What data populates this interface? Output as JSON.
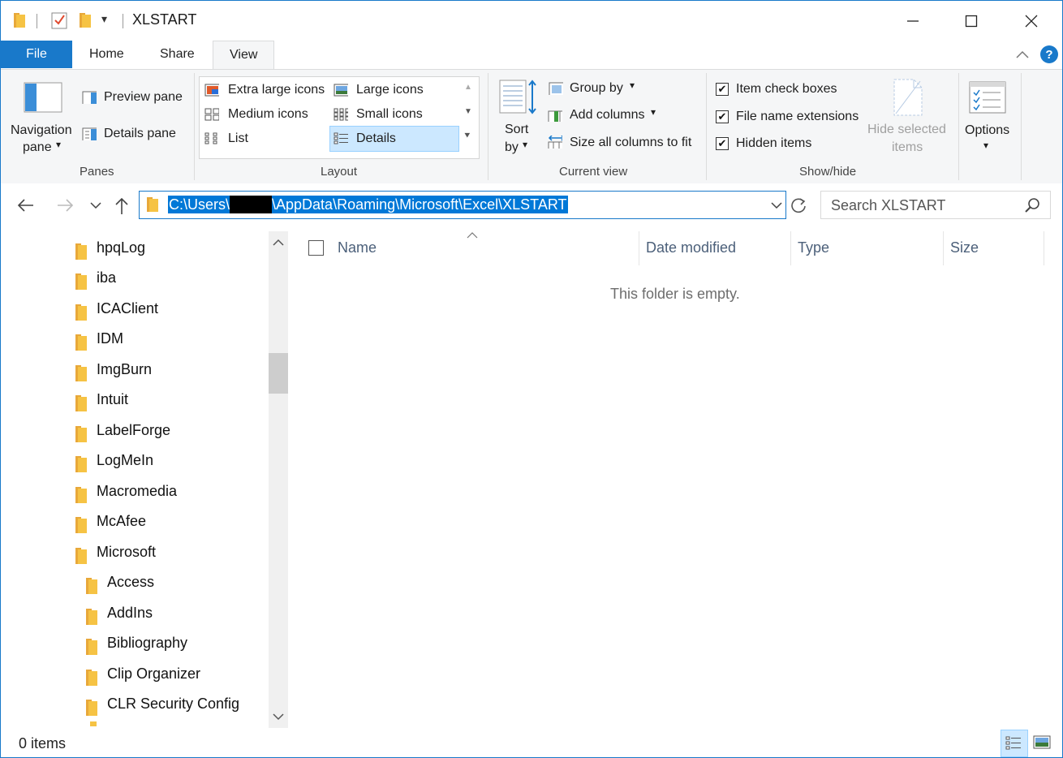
{
  "window": {
    "title": "XLSTART"
  },
  "tabs": [
    "File",
    "Home",
    "Share",
    "View"
  ],
  "ribbon": {
    "panes": {
      "navigation_pane": [
        "Navigation",
        "pane"
      ],
      "preview_pane": "Preview pane",
      "details_pane": "Details pane",
      "group_label": "Panes"
    },
    "layout": {
      "options": [
        "Extra large icons",
        "Large icons",
        "Medium icons",
        "Small icons",
        "List",
        "Details"
      ],
      "selected": "Details",
      "group_label": "Layout"
    },
    "current_view": {
      "sort_by": [
        "Sort",
        "by"
      ],
      "group_by": "Group by",
      "add_columns": "Add columns",
      "size_all_columns": "Size all columns to fit",
      "group_label": "Current view"
    },
    "show_hide": {
      "item_check_boxes": "Item check boxes",
      "file_name_extensions": "File name extensions",
      "hidden_items": "Hidden items",
      "hide_selected_items": [
        "Hide selected",
        "items"
      ],
      "group_label": "Show/hide",
      "checked": [
        true,
        true,
        true
      ]
    },
    "options": "Options"
  },
  "address": {
    "path_start": "C:\\Users\\",
    "path_end": "\\AppData\\Roaming\\Microsoft\\Excel\\XLSTART",
    "search_placeholder": "Search XLSTART"
  },
  "tree": {
    "items": [
      "hpqLog",
      "iba",
      "ICAClient",
      "IDM",
      "ImgBurn",
      "Intuit",
      "LabelForge",
      "LogMeIn",
      "Macromedia",
      "McAfee",
      "Microsoft"
    ],
    "subitems": [
      "Access",
      "AddIns",
      "Bibliography",
      "Clip Organizer",
      "CLR Security Config"
    ]
  },
  "filelist": {
    "columns": [
      "Name",
      "Date modified",
      "Type",
      "Size"
    ],
    "empty_message": "This folder is empty."
  },
  "status": {
    "item_count": "0 items"
  },
  "colors": {
    "accent": "#1979ca",
    "selection": "#0078d7",
    "folder": "#f6c344"
  }
}
